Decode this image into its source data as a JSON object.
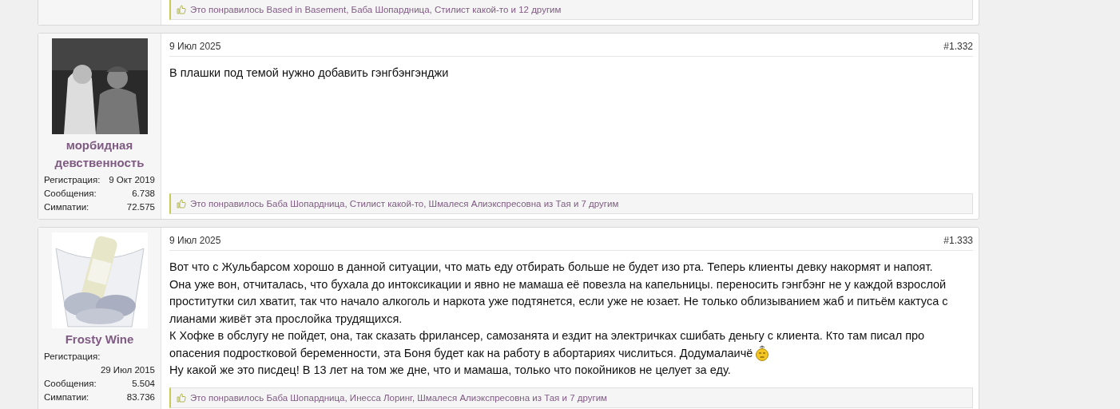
{
  "posts": [
    {
      "kind": "continued",
      "likes": "Это понравилось Based in Basement, Баба Шопардница, Стилист какой-то и 12 другим"
    },
    {
      "kind": "full",
      "avatar": {
        "kind": "picture"
      },
      "username_lines": [
        "морбидная",
        "девственность"
      ],
      "stats": [
        {
          "label": "Регистрация:",
          "value": "9 Окт 2019"
        },
        {
          "label": "Сообщения:",
          "value": "6.738"
        },
        {
          "label": "Симпатии:",
          "value": "72.575"
        }
      ],
      "date": "9 Июл 2025",
      "number": "#1.332",
      "body": [
        {
          "text": "В плашки под темой нужно добавить гэнгбэнгэнджи"
        }
      ],
      "likes": "Это понравилось Баба Шопардница, Стилист какой-то, Шмалеся Алиэкспресовна из Тая и 7 другим"
    },
    {
      "kind": "full",
      "avatar": {
        "kind": "picture"
      },
      "username_lines": [
        "Frosty Wine"
      ],
      "stats": [
        {
          "label": "Регистрация:",
          "value": "29 Июл 2015"
        },
        {
          "label": "Сообщения:",
          "value": "5.504"
        },
        {
          "label": "Симпатии:",
          "value": "83.736"
        }
      ],
      "date": "9 Июл 2025",
      "number": "#1.333",
      "body": [
        {
          "text": "Вот что с Жульбарсом хорошо в данной ситуации, что мать еду отбирать больше не будет изо рта. Теперь клиенты девку накормят и напоят."
        },
        {
          "text": "Она уже вон, отчиталась, что бухала до интоксикации и явно не мамаша её повезла на капельницы. переносить гэнгбэнг не у каждой взрослой проститутки сил хватит, так что начало алкоголь и наркота уже подтянется, если уже не юзает. Не только облизыванием жаб и питьём кактуса с лианами живёт эта прослойка трудящихся."
        },
        {
          "kind": "text",
          "text": "К Хофке в обслугу не пойдет, она, так сказать фрилансер, самозанята и ездит на электричках сшибать деньгу с клиента. Кто там писал про"
        },
        {
          "kind": "text_emoji",
          "text": "опасения подростковой беременности, эта Боня будет как на работу в абортариях числиться. Додумалаичё"
        },
        {
          "text": "Ну какой же это писдец! В 13 лет на том же дне, что и мамаша, только что покойников не целует за еду."
        }
      ],
      "likes": "Это понравилось Баба Шопардница, Инесса Лоринг, Шмалеся Алиэкспресовна из Тая и 7 другим"
    }
  ]
}
